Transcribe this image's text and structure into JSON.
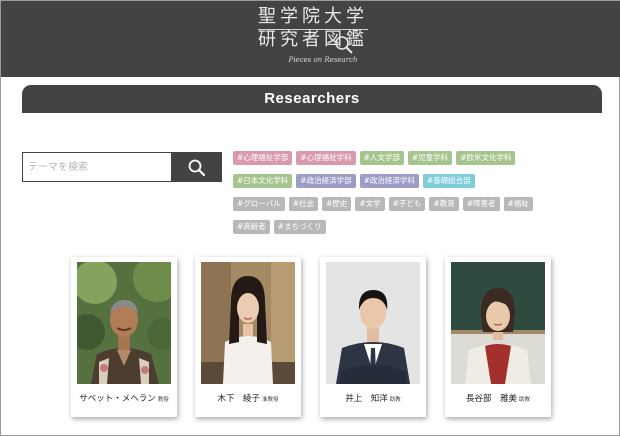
{
  "header": {
    "logo_line1": "聖学院大学",
    "logo_line2": "研究者図鑑",
    "logo_sub": "Pieces on Research"
  },
  "section": {
    "title": "Researchers"
  },
  "search": {
    "placeholder": "テーマを検索"
  },
  "tags": [
    [
      {
        "label": "#心理福祉学部",
        "color": "#d99aad"
      },
      {
        "label": "#心理福祉学科",
        "color": "#d99aad"
      },
      {
        "label": "#人文学部",
        "color": "#a6c48e"
      },
      {
        "label": "#児童学科",
        "color": "#a6c48e"
      },
      {
        "label": "#欧米文化学科",
        "color": "#a6c48e"
      }
    ],
    [
      {
        "label": "#日本文化学科",
        "color": "#a6c48e"
      },
      {
        "label": "#政治経済学部",
        "color": "#9c9cc8"
      },
      {
        "label": "#政治経済学科",
        "color": "#9c9cc8"
      },
      {
        "label": "#基礎総合部",
        "color": "#7fcdd9"
      }
    ],
    [
      {
        "label": "#グローバル",
        "color": "#b8b8b8"
      },
      {
        "label": "#社会",
        "color": "#b8b8b8"
      },
      {
        "label": "#歴史",
        "color": "#b8b8b8"
      },
      {
        "label": "#文学",
        "color": "#b8b8b8"
      },
      {
        "label": "#子ども",
        "color": "#b8b8b8"
      },
      {
        "label": "#教育",
        "color": "#b8b8b8"
      },
      {
        "label": "#障害者",
        "color": "#b8b8b8"
      },
      {
        "label": "#福祉",
        "color": "#b8b8b8"
      }
    ],
    [
      {
        "label": "#高齢者",
        "color": "#b8b8b8"
      },
      {
        "label": "#まちづくり",
        "color": "#b8b8b8"
      }
    ]
  ],
  "researchers": [
    {
      "name": "サベット・メヘラン",
      "title": "教授"
    },
    {
      "name": "木下　綾子",
      "title": "准教授"
    },
    {
      "name": "井上　知洋",
      "title": "助教"
    },
    {
      "name": "長谷部　雅美",
      "title": "助教"
    }
  ],
  "colors": {
    "header_bg": "#434343",
    "tag_psych": "#d99aad",
    "tag_humanities": "#a6c48e",
    "tag_politics": "#9c9cc8",
    "tag_foundation": "#7fcdd9",
    "tag_theme": "#b8b8b8"
  }
}
